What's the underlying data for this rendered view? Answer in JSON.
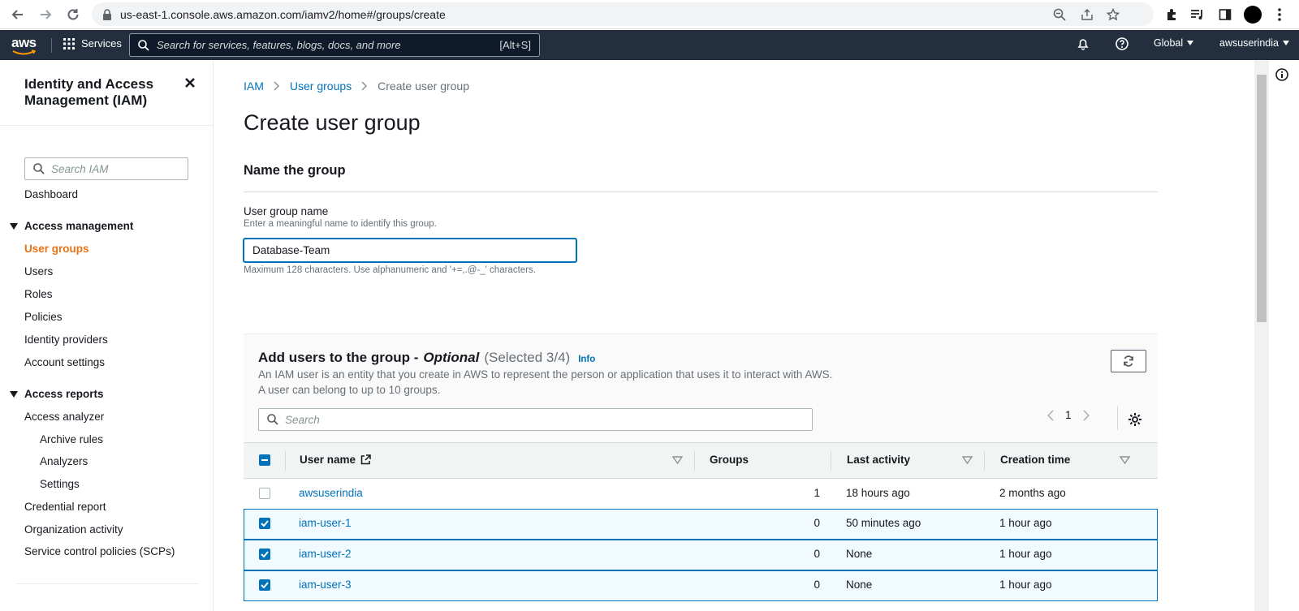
{
  "browser": {
    "url": "us-east-1.console.aws.amazon.com/iamv2/home#/groups/create"
  },
  "aws_nav": {
    "logo": "aws",
    "services_label": "Services",
    "search_placeholder": "Search for services, features, blogs, docs, and more",
    "search_shortcut": "[Alt+S]",
    "region": "Global",
    "account": "awsuserindia"
  },
  "sidebar": {
    "title": "Identity and Access Management (IAM)",
    "search_placeholder": "Search IAM",
    "dashboard": "Dashboard",
    "section_access_management": "Access management",
    "access_management_items": [
      "User groups",
      "Users",
      "Roles",
      "Policies",
      "Identity providers",
      "Account settings"
    ],
    "section_access_reports": "Access reports",
    "access_analyzer": "Access analyzer",
    "access_analyzer_items": [
      "Archive rules",
      "Analyzers",
      "Settings"
    ],
    "report_items": [
      "Credential report",
      "Organization activity",
      "Service control policies (SCPs)"
    ]
  },
  "breadcrumb": {
    "items": [
      "IAM",
      "User groups",
      "Create user group"
    ]
  },
  "page": {
    "title": "Create user group"
  },
  "name_panel": {
    "title": "Name the group",
    "label": "User group name",
    "description": "Enter a meaningful name to identify this group.",
    "value": "Database-Team",
    "constraint": "Maximum 128 characters. Use alphanumeric and '+=,.@-_' characters."
  },
  "users_panel": {
    "title": "Add users to the group -",
    "title_optional": "Optional",
    "selected": "(Selected 3/4)",
    "info": "Info",
    "description": "An IAM user is an entity that you create in AWS to represent the person or application that uses it to interact with AWS. A user can belong to up to 10 groups.",
    "search_placeholder": "Search",
    "page": "1",
    "columns": [
      "User name",
      "Groups",
      "Last activity",
      "Creation time"
    ],
    "rows": [
      {
        "name": "awsuserindia",
        "groups": "1",
        "last_activity": "18 hours ago",
        "creation_time": "2 months ago",
        "selected": false
      },
      {
        "name": "iam-user-1",
        "groups": "0",
        "last_activity": "50 minutes ago",
        "creation_time": "1 hour ago",
        "selected": true
      },
      {
        "name": "iam-user-2",
        "groups": "0",
        "last_activity": "None",
        "creation_time": "1 hour ago",
        "selected": true
      },
      {
        "name": "iam-user-3",
        "groups": "0",
        "last_activity": "None",
        "creation_time": "1 hour ago",
        "selected": true
      }
    ]
  },
  "colors": {
    "aws_nav_bg": "#232f3e",
    "link": "#0073bb",
    "active_nav": "#ec7211"
  }
}
